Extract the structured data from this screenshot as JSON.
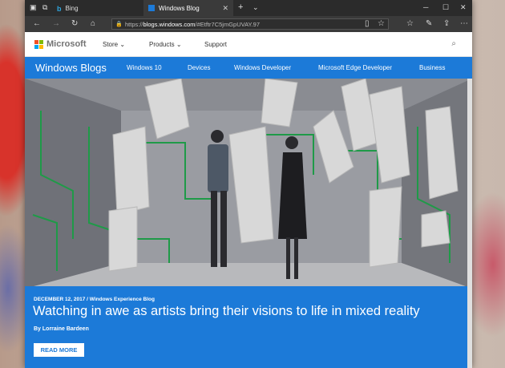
{
  "browser": {
    "tabs": [
      {
        "label": "Bing"
      },
      {
        "label": "Windows Blog"
      }
    ],
    "address": {
      "scheme": "https://",
      "host": "blogs.windows.com",
      "rest": "/#Etftr7C5jmGpUVAY.97"
    }
  },
  "header": {
    "brand": "Microsoft",
    "nav": [
      "Store",
      "Products",
      "Support"
    ],
    "colors": {
      "red": "#f25022",
      "green": "#7fba00",
      "blue": "#00a4ef",
      "yellow": "#ffb900"
    }
  },
  "blog": {
    "title": "Windows Blogs",
    "nav": [
      "Windows 10",
      "Devices",
      "Windows Developer",
      "Microsoft Edge Developer",
      "Business"
    ],
    "accent": "#1c7ad8"
  },
  "article": {
    "date": "DECEMBER 12, 2017",
    "category": "Windows Experience Blog",
    "title": "Watching in awe as artists bring their visions to life in mixed reality",
    "author": "By Lorraine Bardeen",
    "cta": "READ MORE"
  },
  "icons": {
    "tab_actions": [
      "tabs-icon",
      "set-aside-icon",
      "new-tab-icon",
      "tab-list-icon"
    ],
    "nav": [
      "back-icon",
      "forward-icon",
      "refresh-icon",
      "home-icon"
    ],
    "toolbar": [
      "reading-view-icon",
      "favorite-icon",
      "favorites-hub-icon",
      "notes-icon",
      "share-icon",
      "more-icon"
    ],
    "window": [
      "minimize-icon",
      "maximize-icon",
      "close-icon"
    ]
  }
}
